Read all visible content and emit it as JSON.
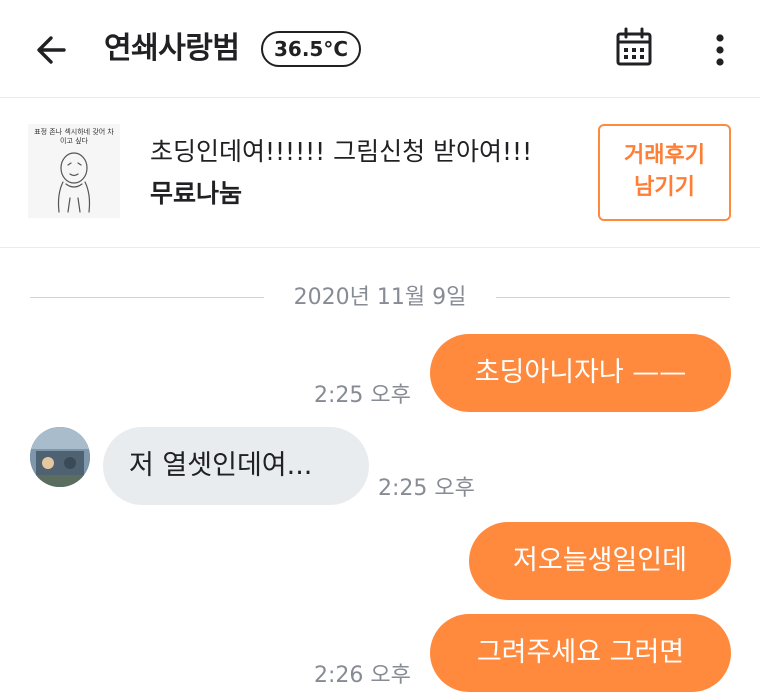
{
  "header": {
    "title": "연쇄사랑범",
    "temperature": "36.5°C"
  },
  "product": {
    "thumbnail_caption": "표정 존나 섹시하네 갖어 차이고 싶다",
    "title": "초딩인데여!!!!!! 그림신청 받아여!!!",
    "price": "무료나눔",
    "review_button": {
      "line1": "거래후기",
      "line2": "남기기"
    }
  },
  "chat": {
    "date": "2020년 11월 9일",
    "messages": [
      {
        "sender": "me",
        "text": "초딩아니자나 ——",
        "time": "2:25 오후"
      },
      {
        "sender": "other",
        "text": "저 열셋인데여...",
        "time": "2:25 오후"
      },
      {
        "sender": "me",
        "text": "저오늘생일인데",
        "time": ""
      },
      {
        "sender": "me",
        "text": "그려주세요 그러면",
        "time": "2:26 오후"
      }
    ]
  },
  "colors": {
    "accent": "#ff8a3d",
    "accent_text": "#ff7e36",
    "bubble_other": "#e9ecef",
    "muted_text": "#868b94",
    "divider": "#e9ecef"
  },
  "icons": {
    "back": "arrow-left-icon",
    "calendar": "calendar-icon",
    "more": "more-vertical-icon"
  }
}
